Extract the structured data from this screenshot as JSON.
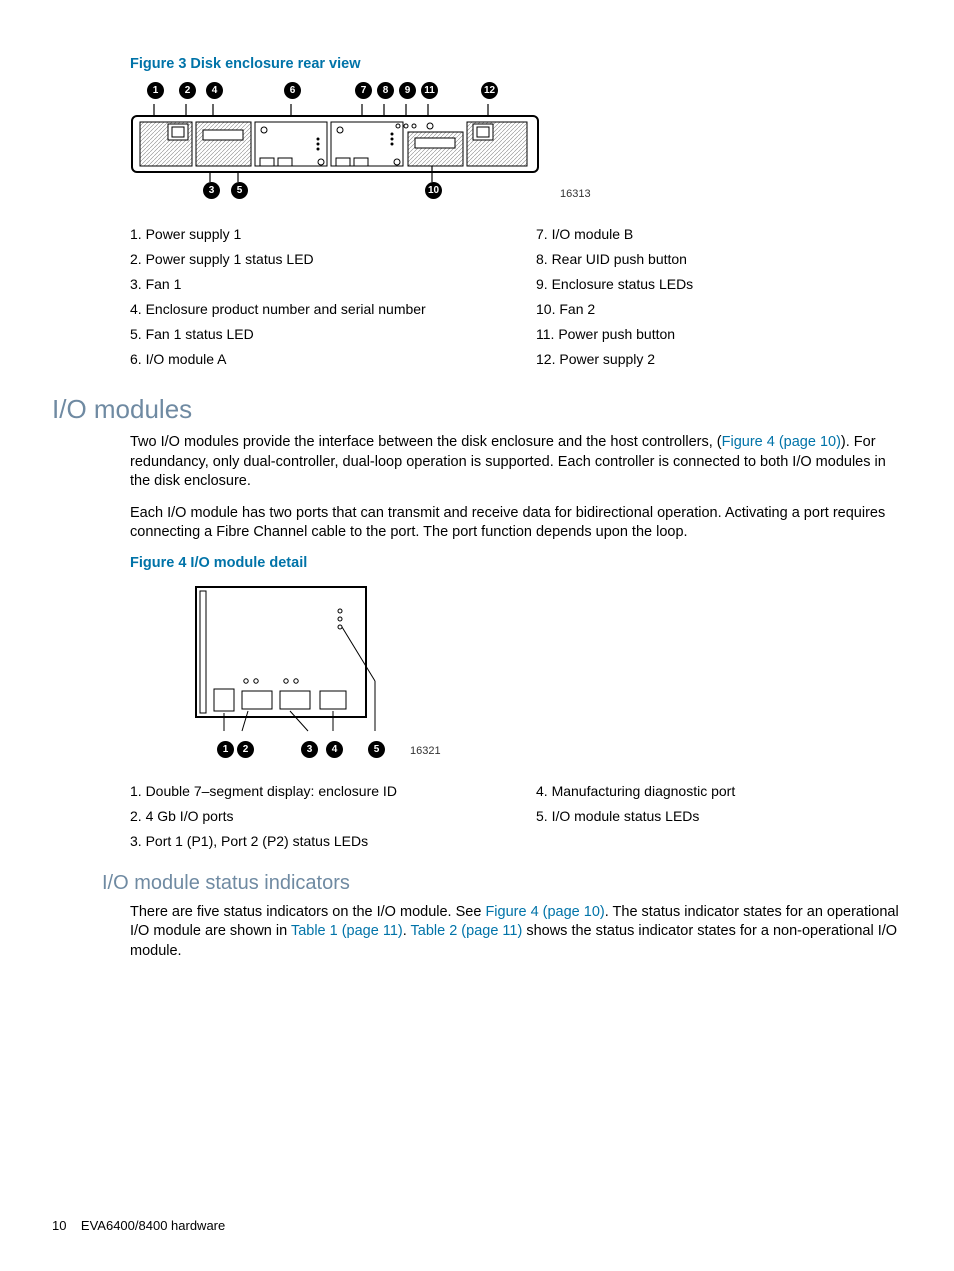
{
  "figure3": {
    "caption": "Figure 3 Disk enclosure rear view",
    "diagram_id": "16313",
    "callouts_top": [
      "1",
      "2",
      "4",
      "6",
      "7",
      "8",
      "9",
      "11",
      "12"
    ],
    "callouts_bottom": [
      "3",
      "5",
      "10"
    ],
    "legend_left": [
      "1. Power supply 1",
      "2. Power supply 1 status LED",
      "3. Fan 1",
      "4. Enclosure product number and serial number",
      "5. Fan 1 status LED",
      "6. I/O module A"
    ],
    "legend_right": [
      "7. I/O module B",
      "8. Rear UID push button",
      "9. Enclosure status LEDs",
      "10. Fan 2",
      "11. Power push button",
      "12. Power supply 2"
    ]
  },
  "section_io_modules": {
    "heading": "I/O modules",
    "para1_a": "Two I/O modules provide the interface between the disk enclosure and the host controllers, (",
    "para1_link": "Figure 4 (page 10)",
    "para1_b": "). For redundancy, only dual-controller, dual-loop operation is supported. Each controller is connected to both I/O modules in the disk enclosure.",
    "para2": "Each I/O module has two ports that can transmit and receive data for bidirectional operation. Activating a port requires connecting a Fibre Channel cable to the port. The port function depends upon the loop."
  },
  "figure4": {
    "caption": "Figure 4 I/O module detail",
    "diagram_id": "16321",
    "callouts": [
      "1",
      "2",
      "3",
      "4",
      "5"
    ],
    "legend_left": [
      "1. Double 7–segment display: enclosure ID",
      "2. 4 Gb I/O ports",
      "3. Port 1 (P1), Port 2 (P2) status LEDs"
    ],
    "legend_right": [
      "4. Manufacturing diagnostic port",
      "5. I/O module status LEDs"
    ]
  },
  "section_status": {
    "heading": "I/O module status indicators",
    "para_a": "There are five status indicators on the I/O module. See ",
    "link1": "Figure 4 (page 10)",
    "para_b": ". The status indicator states for an operational I/O module are shown in ",
    "link2": "Table 1 (page 11)",
    "para_c": ". ",
    "link3": "Table 2 (page 11)",
    "para_d": " shows the status indicator states for a non-operational I/O module."
  },
  "footer": {
    "page_num": "10",
    "doc_title": "EVA6400/8400 hardware"
  }
}
